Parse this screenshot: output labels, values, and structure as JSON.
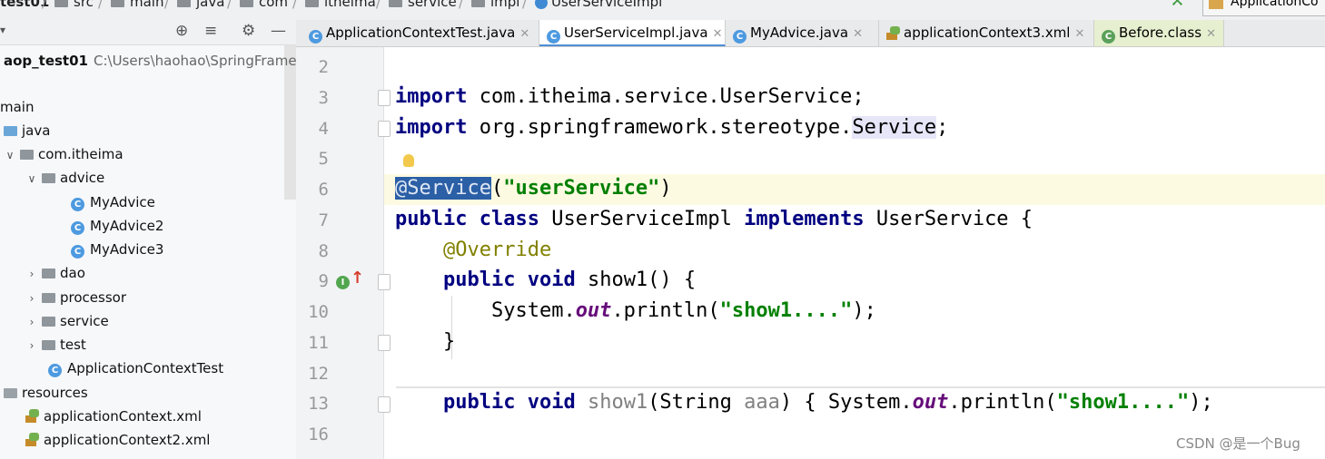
{
  "breadcrumb": {
    "items": [
      "test01",
      "src",
      "main",
      "java",
      "com",
      "itheima",
      "service",
      "impl",
      "UserServiceImpl"
    ],
    "run_config": "ApplicationCo"
  },
  "project_panel": {
    "root_name": "aop_test01",
    "root_path": "C:\\Users\\haohao\\SpringFramew",
    "items": [
      {
        "label": "main"
      },
      {
        "label": "java"
      },
      {
        "label": "com.itheima"
      },
      {
        "label": "advice"
      },
      {
        "label": "MyAdvice"
      },
      {
        "label": "MyAdvice2"
      },
      {
        "label": "MyAdvice3"
      },
      {
        "label": "dao"
      },
      {
        "label": "processor"
      },
      {
        "label": "service"
      },
      {
        "label": "test"
      },
      {
        "label": "ApplicationContextTest"
      },
      {
        "label": "resources"
      },
      {
        "label": "applicationContext.xml"
      },
      {
        "label": "applicationContext2.xml"
      }
    ]
  },
  "tabs": [
    {
      "label": "ApplicationContextTest.java"
    },
    {
      "label": "UserServiceImpl.java"
    },
    {
      "label": "MyAdvice.java"
    },
    {
      "label": "applicationContext3.xml"
    },
    {
      "label": "Before.class"
    }
  ],
  "editor": {
    "line_numbers": [
      "2",
      "3",
      "4",
      "5",
      "6",
      "7",
      "8",
      "9",
      "10",
      "11",
      "12",
      "13",
      "16"
    ],
    "tokens": {
      "import": "import",
      "import_1_path": "com.itheima.service.UserService;",
      "import_2_path": "org.springframework.stereotype.",
      "service_word": "Service",
      "semicolon": ";",
      "at_service": "@Servic",
      "at_service_e": "e",
      "service_args_open": "(",
      "service_value": "\"userService\"",
      "service_args_close": ")",
      "public": "public",
      "class": "class",
      "class_name": "UserServiceImpl",
      "implements": "implements",
      "interface_brace": "UserService {",
      "override": "@Override",
      "void": "void",
      "show1_decl": "show1() {",
      "system": "System.",
      "out": "out",
      "println_open": ".println(",
      "show1_str": "\"show1....\"",
      "println_close": ");",
      "close_brace": "}",
      "show1_unused": "show1",
      "overload_params": "(String ",
      "param_aaa": "aaa",
      "overload_close": ")",
      "open_brace": "{",
      "folded_tail": ");"
    }
  },
  "watermark": "CSDN @是一个Bug"
}
